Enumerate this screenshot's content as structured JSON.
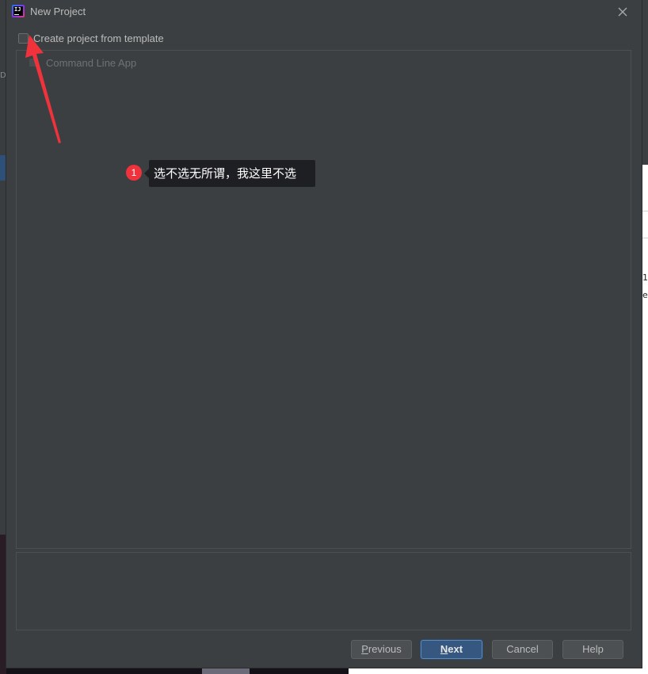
{
  "dialog": {
    "title": "New Project",
    "app_icon_text": "IJ"
  },
  "template": {
    "checkbox_label": "Create project from template",
    "checked": false,
    "items": [
      {
        "label": "Command Line App"
      }
    ]
  },
  "buttons": {
    "previous_pre": "",
    "previous_mn": "P",
    "previous_post": "revious",
    "next_pre": "",
    "next_mn": "N",
    "next_post": "ext",
    "cancel": "Cancel",
    "help": "Help"
  },
  "annotation": {
    "step_number": "1",
    "text": "选不选无所谓，我这里不选"
  },
  "background": {
    "left_fragment": "DE",
    "right_fragments": [
      "1",
      "e"
    ]
  },
  "colors": {
    "dialog_bg": "#3c3f41",
    "panel_border": "#4c5052",
    "text": "#bbbbbb",
    "disabled_text": "#6f7274",
    "default_button": "#365880",
    "annotation_red": "#f0323c",
    "tooltip_bg": "#1e1f22"
  }
}
